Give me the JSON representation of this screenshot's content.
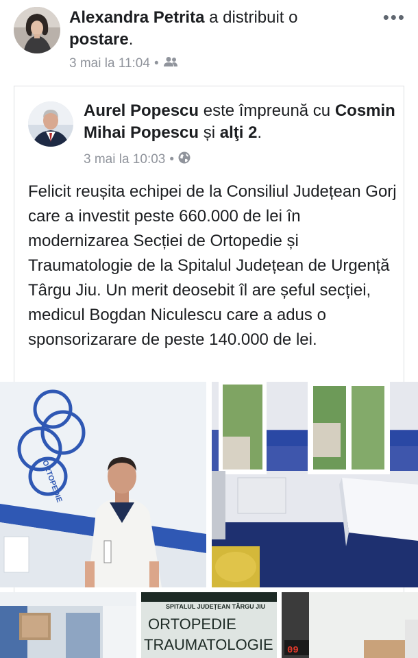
{
  "outer_post": {
    "author": "Alexandra Petrita",
    "action_a": " a distribuit o ",
    "action_b": "postare",
    "action_end": ".",
    "timestamp": "3 mai la 11:04",
    "separator": "•",
    "audience_icon": "friends-icon",
    "more_label": "•••"
  },
  "shared_post": {
    "author": "Aurel Popescu",
    "with_text": " este împreună cu ",
    "tagged": "Cosmin Mihai Popescu",
    "and_text": " și ",
    "others": "alţi 2",
    "end": ".",
    "timestamp": "3 mai la 10:03",
    "separator": "•",
    "audience_icon": "globe-icon",
    "body": "Felicit reușita echipei de la Consiliul Județean Gorj care a investit peste 660.000 de lei în modernizarea Secției de Ortopedie și Traumatologie de la Spitalul Județean de Urgență Târgu Jiu. Un merit deosebit îl are șeful secției, medicul Bogdan Niculescu care a adus o sponsorizarare de peste 140.000 de lei."
  },
  "photos": {
    "wall_logo": "ORTOPEDIE",
    "sign_top": "SPITALUL JUDEȚEAN TÂRGU JIU",
    "sign_line1": "ORTOPEDIE",
    "sign_line2": "TRAUMATOLOGIE",
    "clock": "09"
  },
  "colors": {
    "link_text": "#1c1e21",
    "meta_text": "#90949c",
    "wall_stripe": "#2f58b4",
    "card_border": "#dddfe2"
  }
}
